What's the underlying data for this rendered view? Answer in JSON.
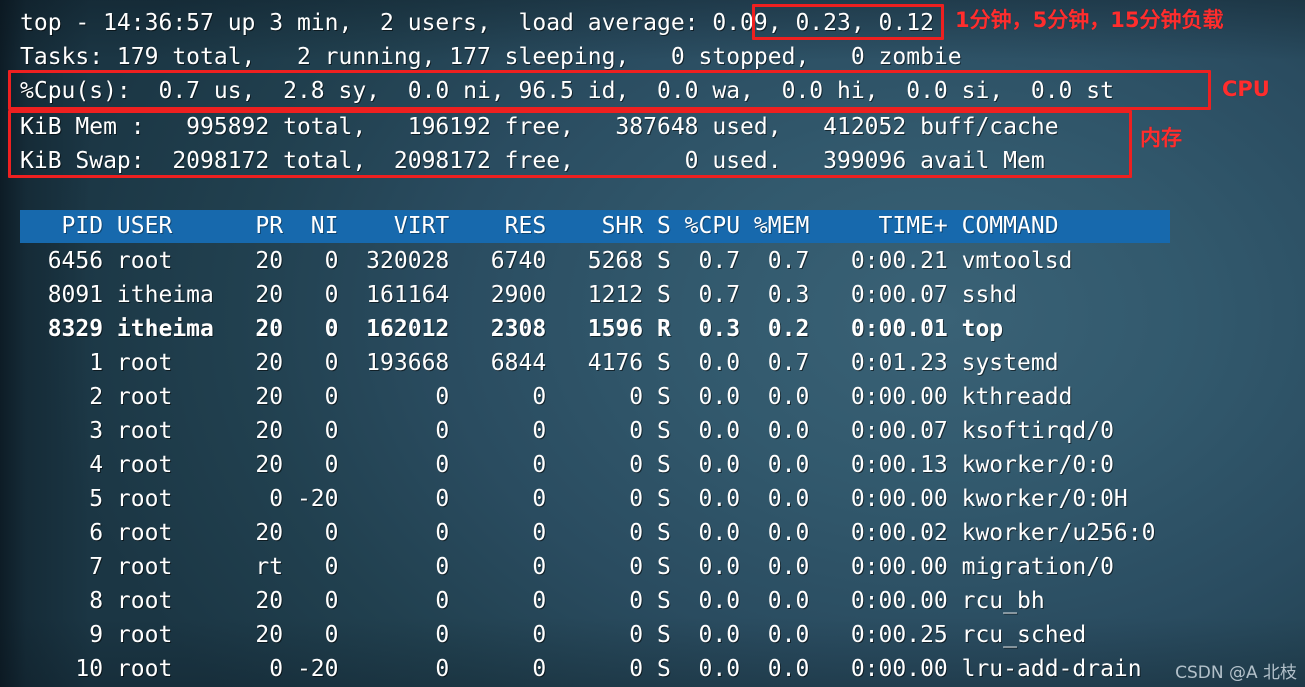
{
  "terminal": {
    "background_color": "#2d5265",
    "text_color": "#ffffff",
    "header_row_color": "#1769ad",
    "annotation_color": "#ff2d2d"
  },
  "summary": {
    "uptime_line": "top - 14:36:57 up 3 min,  2 users,  load average: 0.09, 0.23, 0.12",
    "uptime_prefix": "top - 14:36:57 up 3 min,  2 users,  load average: ",
    "load_average": "0.09, 0.23, 0.12",
    "time": "14:36:57",
    "uptime": "3 min",
    "users": "2 users",
    "load_1min": "0.09",
    "load_5min": "0.23",
    "load_15min": "0.12",
    "tasks_line": "Tasks: 179 total,   2 running, 177 sleeping,   0 stopped,   0 zombie",
    "tasks_total": "179",
    "tasks_running": "2",
    "tasks_sleeping": "177",
    "tasks_stopped": "0",
    "tasks_zombie": "0",
    "cpu_line": "%Cpu(s):  0.7 us,  2.8 sy,  0.0 ni, 96.5 id,  0.0 wa,  0.0 hi,  0.0 si,  0.0 st",
    "cpu_us": "0.7",
    "cpu_sy": "2.8",
    "cpu_ni": "0.0",
    "cpu_id": "96.5",
    "cpu_wa": "0.0",
    "cpu_hi": "0.0",
    "cpu_si": "0.0",
    "cpu_st": "0.0",
    "mem_line": "KiB Mem :   995892 total,   196192 free,   387648 used,   412052 buff/cache",
    "mem_total": "995892",
    "mem_free": "196192",
    "mem_used": "387648",
    "mem_buff_cache": "412052",
    "swap_line": "KiB Swap:  2098172 total,  2098172 free,        0 used.   399096 avail Mem",
    "swap_total": "2098172",
    "swap_free": "2098172",
    "swap_used": "0",
    "avail_mem": "399096"
  },
  "annotations": {
    "load_average": "1分钟，5分钟，15分钟负载",
    "cpu": "CPU",
    "memory": "内存"
  },
  "table": {
    "header_line": "   PID USER      PR  NI    VIRT    RES    SHR S %CPU %MEM     TIME+ COMMAND",
    "columns": [
      "PID",
      "USER",
      "PR",
      "NI",
      "VIRT",
      "RES",
      "SHR",
      "S",
      "%CPU",
      "%MEM",
      "TIME+",
      "COMMAND"
    ],
    "rows": [
      {
        "line": "  6456 root      20   0  320028   6740   5268 S  0.7  0.7   0:00.21 vmtoolsd",
        "pid": "6456",
        "user": "root",
        "pr": "20",
        "ni": "0",
        "virt": "320028",
        "res": "6740",
        "shr": "5268",
        "s": "S",
        "cpu": "0.7",
        "mem": "0.7",
        "time": "0:00.21",
        "command": "vmtoolsd",
        "bold": false
      },
      {
        "line": "  8091 itheima   20   0  161164   2900   1212 S  0.7  0.3   0:00.07 sshd",
        "pid": "8091",
        "user": "itheima",
        "pr": "20",
        "ni": "0",
        "virt": "161164",
        "res": "2900",
        "shr": "1212",
        "s": "S",
        "cpu": "0.7",
        "mem": "0.3",
        "time": "0:00.07",
        "command": "sshd",
        "bold": false
      },
      {
        "line": "  8329 itheima   20   0  162012   2308   1596 R  0.3  0.2   0:00.01 top",
        "pid": "8329",
        "user": "itheima",
        "pr": "20",
        "ni": "0",
        "virt": "162012",
        "res": "2308",
        "shr": "1596",
        "s": "R",
        "cpu": "0.3",
        "mem": "0.2",
        "time": "0:00.01",
        "command": "top",
        "bold": true
      },
      {
        "line": "     1 root      20   0  193668   6844   4176 S  0.0  0.7   0:01.23 systemd",
        "pid": "1",
        "user": "root",
        "pr": "20",
        "ni": "0",
        "virt": "193668",
        "res": "6844",
        "shr": "4176",
        "s": "S",
        "cpu": "0.0",
        "mem": "0.7",
        "time": "0:01.23",
        "command": "systemd",
        "bold": false
      },
      {
        "line": "     2 root      20   0       0      0      0 S  0.0  0.0   0:00.00 kthreadd",
        "pid": "2",
        "user": "root",
        "pr": "20",
        "ni": "0",
        "virt": "0",
        "res": "0",
        "shr": "0",
        "s": "S",
        "cpu": "0.0",
        "mem": "0.0",
        "time": "0:00.00",
        "command": "kthreadd",
        "bold": false
      },
      {
        "line": "     3 root      20   0       0      0      0 S  0.0  0.0   0:00.07 ksoftirqd/0",
        "pid": "3",
        "user": "root",
        "pr": "20",
        "ni": "0",
        "virt": "0",
        "res": "0",
        "shr": "0",
        "s": "S",
        "cpu": "0.0",
        "mem": "0.0",
        "time": "0:00.07",
        "command": "ksoftirqd/0",
        "bold": false
      },
      {
        "line": "     4 root      20   0       0      0      0 S  0.0  0.0   0:00.13 kworker/0:0",
        "pid": "4",
        "user": "root",
        "pr": "20",
        "ni": "0",
        "virt": "0",
        "res": "0",
        "shr": "0",
        "s": "S",
        "cpu": "0.0",
        "mem": "0.0",
        "time": "0:00.13",
        "command": "kworker/0:0",
        "bold": false
      },
      {
        "line": "     5 root       0 -20       0      0      0 S  0.0  0.0   0:00.00 kworker/0:0H",
        "pid": "5",
        "user": "root",
        "pr": "0",
        "ni": "-20",
        "virt": "0",
        "res": "0",
        "shr": "0",
        "s": "S",
        "cpu": "0.0",
        "mem": "0.0",
        "time": "0:00.00",
        "command": "kworker/0:0H",
        "bold": false
      },
      {
        "line": "     6 root      20   0       0      0      0 S  0.0  0.0   0:00.02 kworker/u256:0",
        "pid": "6",
        "user": "root",
        "pr": "20",
        "ni": "0",
        "virt": "0",
        "res": "0",
        "shr": "0",
        "s": "S",
        "cpu": "0.0",
        "mem": "0.0",
        "time": "0:00.02",
        "command": "kworker/u256:0",
        "bold": false
      },
      {
        "line": "     7 root      rt   0       0      0      0 S  0.0  0.0   0:00.00 migration/0",
        "pid": "7",
        "user": "root",
        "pr": "rt",
        "ni": "0",
        "virt": "0",
        "res": "0",
        "shr": "0",
        "s": "S",
        "cpu": "0.0",
        "mem": "0.0",
        "time": "0:00.00",
        "command": "migration/0",
        "bold": false
      },
      {
        "line": "     8 root      20   0       0      0      0 S  0.0  0.0   0:00.00 rcu_bh",
        "pid": "8",
        "user": "root",
        "pr": "20",
        "ni": "0",
        "virt": "0",
        "res": "0",
        "shr": "0",
        "s": "S",
        "cpu": "0.0",
        "mem": "0.0",
        "time": "0:00.00",
        "command": "rcu_bh",
        "bold": false
      },
      {
        "line": "     9 root      20   0       0      0      0 S  0.0  0.0   0:00.25 rcu_sched",
        "pid": "9",
        "user": "root",
        "pr": "20",
        "ni": "0",
        "virt": "0",
        "res": "0",
        "shr": "0",
        "s": "S",
        "cpu": "0.0",
        "mem": "0.0",
        "time": "0:00.25",
        "command": "rcu_sched",
        "bold": false
      },
      {
        "line": "    10 root       0 -20       0      0      0 S  0.0  0.0   0:00.00 lru-add-drain",
        "pid": "10",
        "user": "root",
        "pr": "0",
        "ni": "-20",
        "virt": "0",
        "res": "0",
        "shr": "0",
        "s": "S",
        "cpu": "0.0",
        "mem": "0.0",
        "time": "0:00.00",
        "command": "lru-add-drain",
        "bold": false
      }
    ]
  },
  "watermark": "CSDN @A 北枝"
}
